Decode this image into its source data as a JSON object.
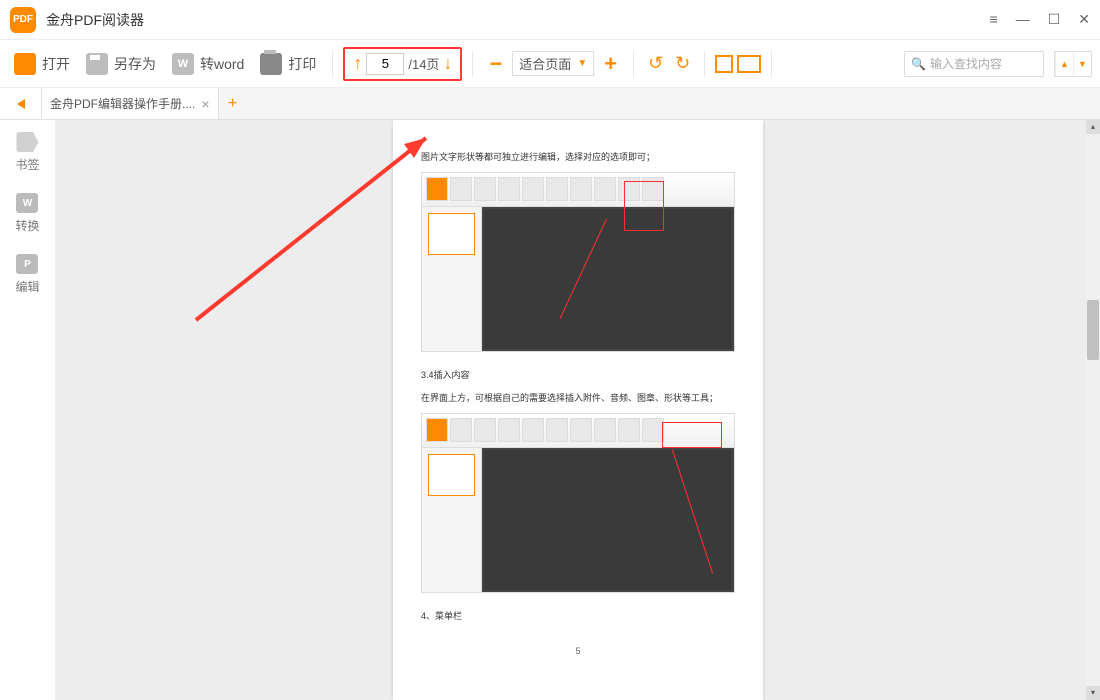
{
  "app": {
    "title": "金舟PDF阅读器"
  },
  "toolbar": {
    "open": "打开",
    "saveas": "另存为",
    "toword": "转word",
    "print": "打印",
    "page_current": "5",
    "page_total": "/14页",
    "fit_mode": "适合页面",
    "search_placeholder": "输入查找内容"
  },
  "tab": {
    "name": "金舟PDF编辑器操作手册...."
  },
  "sidebar": {
    "items": [
      {
        "label": "书签"
      },
      {
        "label": "转换"
      },
      {
        "label": "编辑"
      }
    ]
  },
  "doc": {
    "line1": "图片文字形状等都可独立进行编辑，选择对应的选项即可；",
    "sec_title": "3.4插入内容",
    "sec_text": "在界面上方，可根据自己的需要选择插入附件、音频、图章、形状等工具；",
    "menu_title": "4、菜单栏",
    "pagenum": "5"
  }
}
